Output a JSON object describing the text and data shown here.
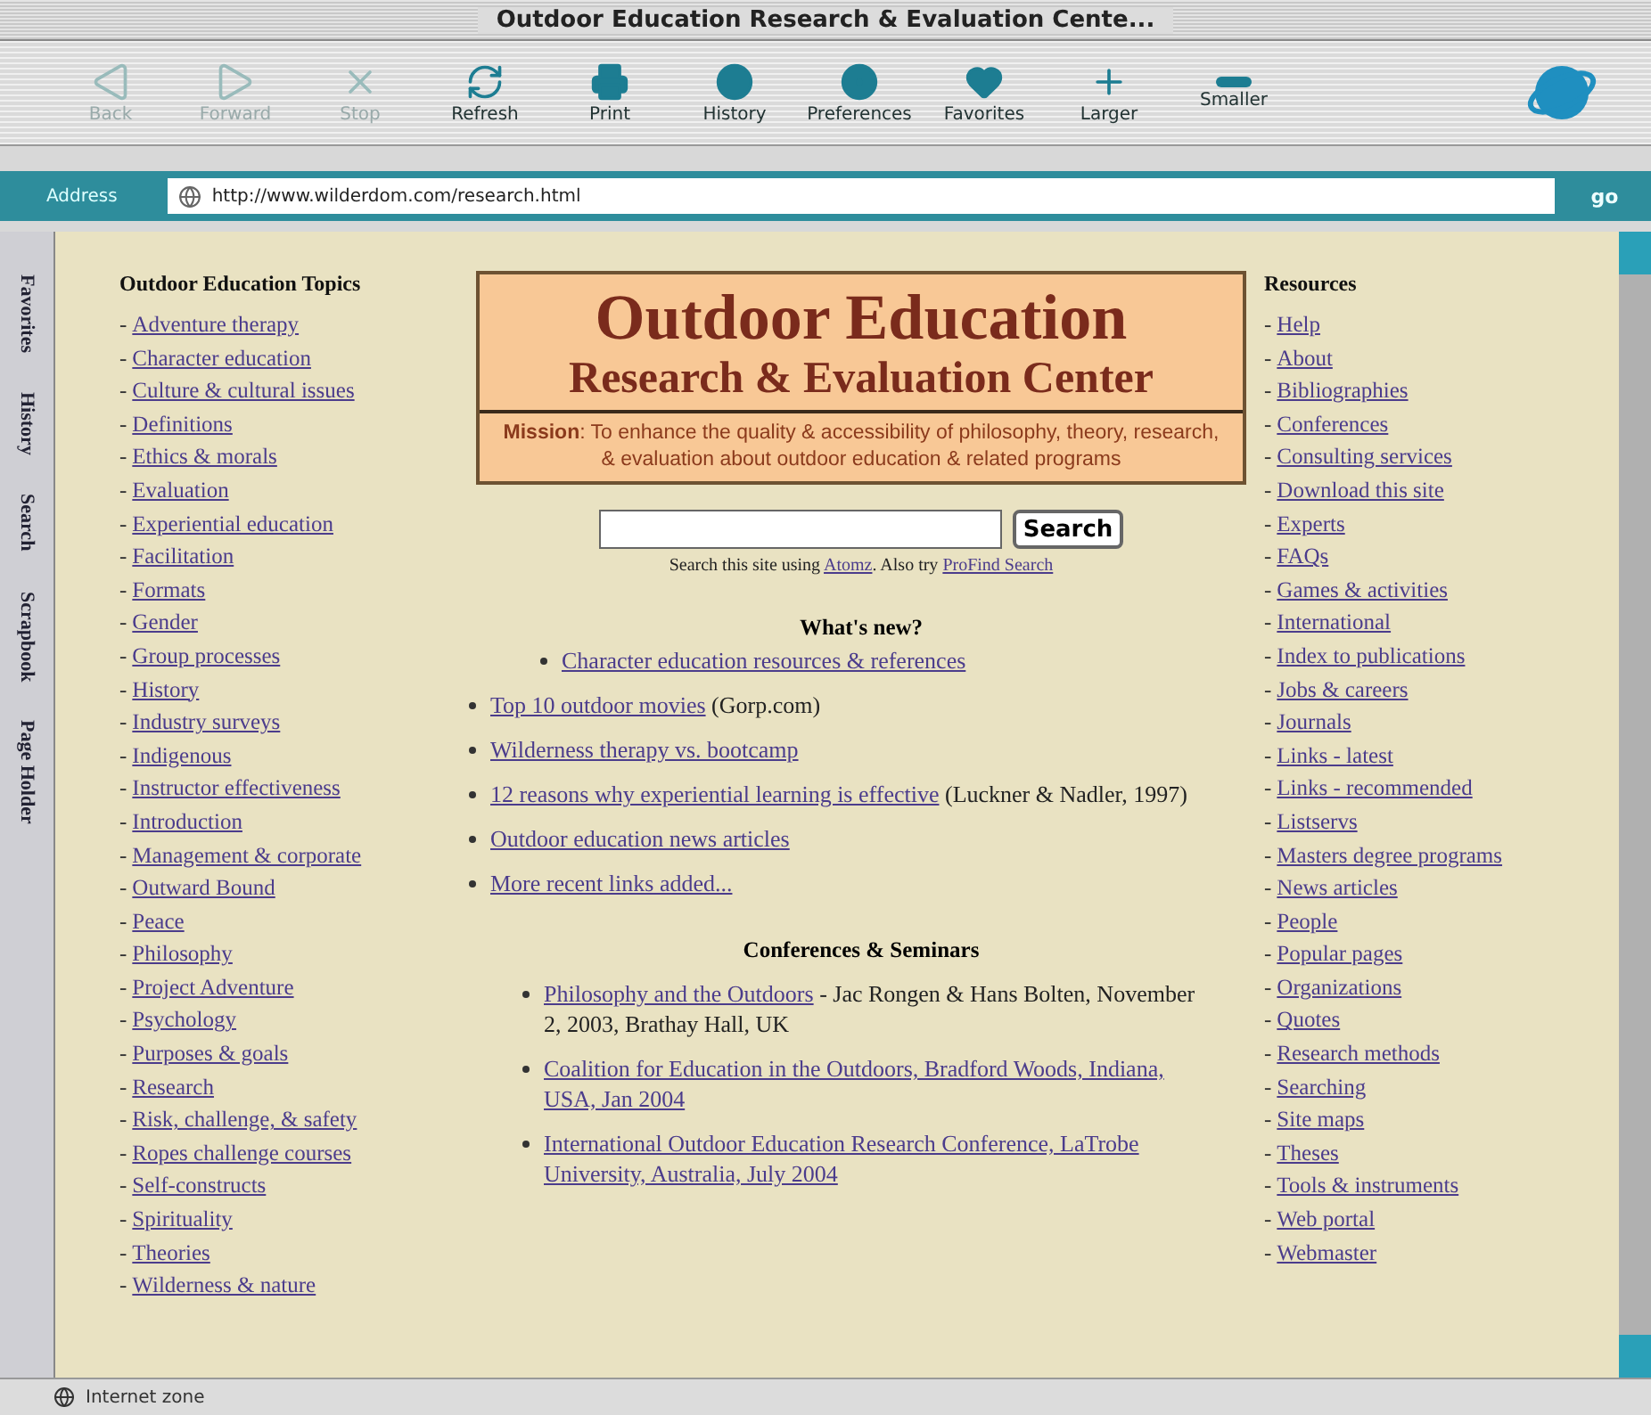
{
  "window": {
    "title": "Outdoor Education Research & Evaluation Cente..."
  },
  "toolbar": [
    {
      "label": "Back",
      "disabled": true
    },
    {
      "label": "Forward",
      "disabled": true
    },
    {
      "label": "Stop",
      "disabled": true
    },
    {
      "label": "Refresh",
      "disabled": false
    },
    {
      "label": "Print",
      "disabled": false
    },
    {
      "label": "History",
      "disabled": false
    },
    {
      "label": "Preferences",
      "disabled": false
    },
    {
      "label": "Favorites",
      "disabled": false
    },
    {
      "label": "Larger",
      "disabled": false
    },
    {
      "label": "Smaller",
      "disabled": false
    }
  ],
  "address_bar": {
    "label": "Address",
    "value": "http://www.wilderdom.com/research.html",
    "go": "go"
  },
  "side_tabs": [
    "Favorites",
    "History",
    "Search",
    "Scrapbook",
    "Page Holder"
  ],
  "left_column": {
    "heading": "Outdoor Education Topics",
    "dash": "-",
    "items": [
      "Adventure therapy",
      "Character education",
      "Culture & cultural issues",
      "Definitions",
      "Ethics & morals",
      "Evaluation",
      "Experiential education",
      "Facilitation",
      "Formats",
      "Gender",
      "Group processes",
      "History",
      "Industry surveys",
      "Indigenous",
      "Instructor effectiveness",
      "Introduction",
      "Management & corporate",
      "Outward Bound",
      "Peace",
      "Philosophy",
      "Project Adventure",
      "Psychology",
      "Purposes & goals",
      "Research",
      "Risk, challenge, & safety",
      "Ropes challenge courses",
      "Self-constructs",
      "Spirituality",
      "Theories",
      "Wilderness & nature"
    ]
  },
  "banner": {
    "title": "Outdoor Education",
    "subtitle": "Research & Evaluation Center",
    "mission": "**Mission**: To enhance the quality & accessibility of philosophy, theory, research, & evaluation about outdoor education & related programs"
  },
  "search": {
    "button": "Search",
    "note": {
      "text_1": "Search this site using ",
      "link_1": "Atomz",
      "text_2": ". Also try ",
      "link_2": "ProFind Search"
    }
  },
  "whats_new": {
    "heading": "What's new?",
    "items": [
      {
        "kind": "inner",
        "link": "Character education resources & references"
      },
      {
        "kind": "outer",
        "link": "Top 10 outdoor movies",
        "note": " (Gorp.com)"
      },
      {
        "kind": "outer",
        "link": "Wilderness therapy vs. bootcamp"
      },
      {
        "kind": "outer",
        "link": "12 reasons why experiential learning is effective",
        "note": " (Luckner & Nadler, 1997)"
      },
      {
        "kind": "outer",
        "link": "Outdoor education news articles"
      },
      {
        "kind": "outer",
        "link": "More recent links added..."
      }
    ]
  },
  "conferences": {
    "heading": "Conferences & Seminars",
    "items": [
      {
        "link": "Philosophy and the Outdoors",
        "note": " - Jac Rongen & Hans Bolten, November 2, 2003, Brathay Hall, UK"
      },
      {
        "link": "Coalition for Education in the Outdoors, Bradford Woods, Indiana, USA, Jan 2004"
      },
      {
        "link": "International Outdoor Education Research Conference, LaTrobe University, Australia, July 2004"
      }
    ]
  },
  "right_column": {
    "heading": "Resources",
    "dash": "-",
    "items": [
      "Help",
      "About",
      "Bibliographies",
      "Conferences",
      "Consulting services",
      "Download this site",
      "Experts",
      "FAQs",
      "Games & activities",
      "International",
      "Index to publications",
      "Jobs & careers",
      "Journals",
      "Links - latest",
      "Links - recommended",
      "Listservs",
      "Masters degree programs",
      "News articles",
      "People",
      "Popular pages",
      "Organizations",
      "Quotes",
      "Research methods",
      "Searching",
      "Site maps",
      "Theses",
      "Tools & instruments",
      "Web portal",
      "Webmaster"
    ]
  },
  "status_bar": {
    "text": "Internet zone"
  }
}
